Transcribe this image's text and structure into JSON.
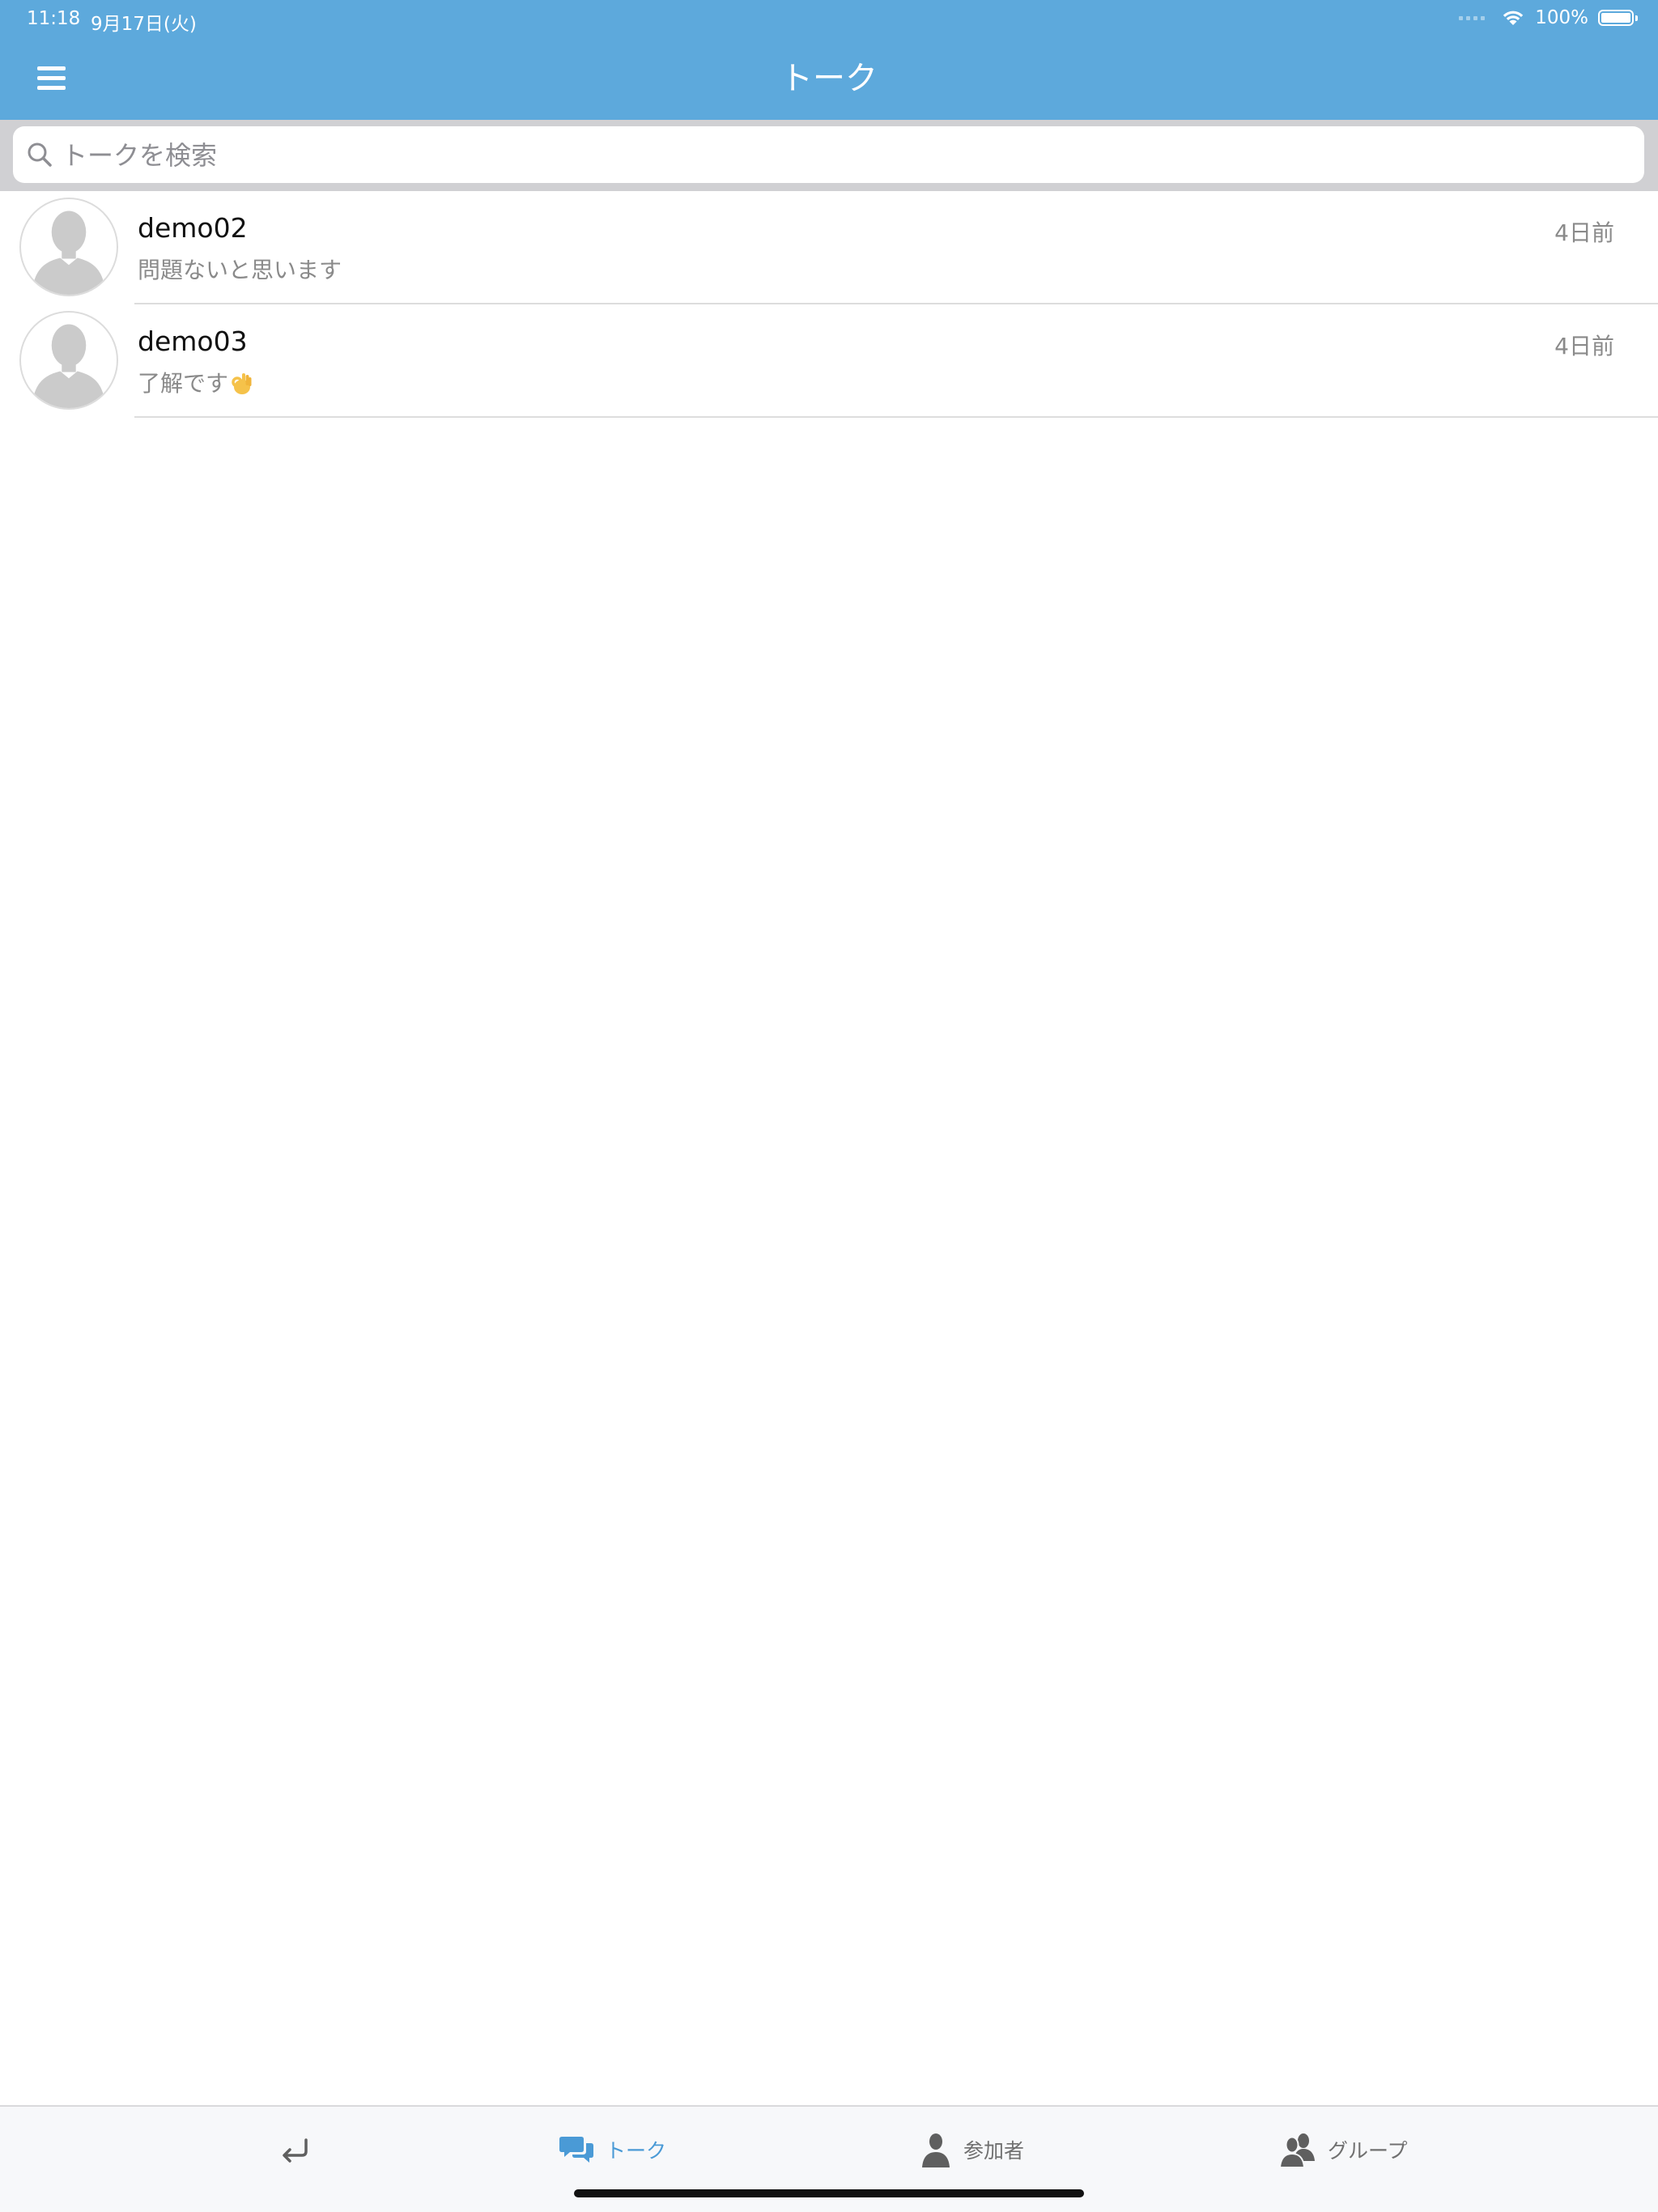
{
  "status_bar": {
    "time": "11:18",
    "date": "9月17日(火)",
    "battery": "100%",
    "icons": [
      "cellular-dots-icon",
      "wifi-icon",
      "battery-icon"
    ]
  },
  "header": {
    "title": "トーク",
    "menu_icon": "hamburger-menu-icon",
    "color": "#5da9dc"
  },
  "search": {
    "placeholder": "トークを検索",
    "value": "",
    "icon": "search-icon"
  },
  "talks": [
    {
      "name": "demo02",
      "message": "問題ないと思います",
      "time": "4日前",
      "emoji": ""
    },
    {
      "name": "demo03",
      "message": "了解です",
      "time": "4日前",
      "emoji": "ok-hand"
    }
  ],
  "tabs": [
    {
      "label": "",
      "icon": "return-arrow-icon",
      "active": false
    },
    {
      "label": "トーク",
      "icon": "chat-bubbles-icon",
      "active": true
    },
    {
      "label": "参加者",
      "icon": "person-icon",
      "active": false
    },
    {
      "label": "グループ",
      "icon": "group-icon",
      "active": false
    }
  ],
  "colors": {
    "accent": "#4a9ad6",
    "header": "#5da9dc",
    "secondary_text": "#8a8a8a"
  }
}
